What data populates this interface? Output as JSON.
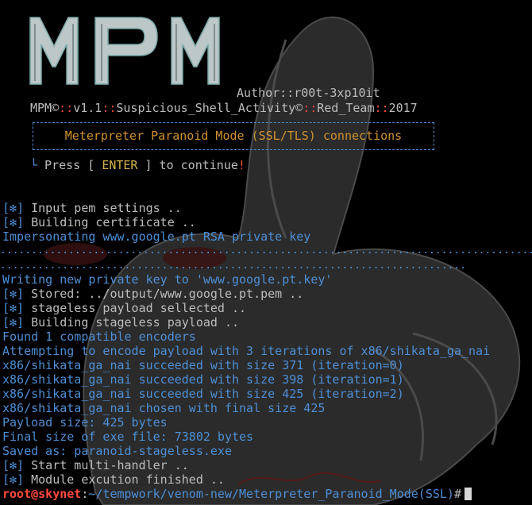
{
  "logo": {
    "text": "MPM"
  },
  "author_line": "Author::r00t-3xp10it",
  "version_line": {
    "part1": "MPM©",
    "sep1": "::",
    "part2": "v1.1",
    "sep2": "::",
    "part3": "Suspicious_Shell_Activity©",
    "sep3": "::",
    "part4": "Red_Team",
    "sep4": "::",
    "part5": "2017"
  },
  "banner": {
    "title": "Meterpreter Paranoid Mode (SSL/TLS) connections"
  },
  "continue": {
    "corner": "└",
    "pre": " Press [ ",
    "key": "ENTER",
    "post": " ] to continue",
    "bang": "!"
  },
  "log": [
    {
      "tag": "[✻]",
      "text": " Input pem settings .."
    },
    {
      "tag": "[✻]",
      "text": " Building certificate .."
    },
    {
      "text": "Impersonating www.google.pt RSA private key"
    }
  ],
  "dots_row1": "................................................................................................................",
  "dots_row2": "...........................................................................",
  "log2": [
    {
      "text": "Writing new private key to 'www.google.pt.key'"
    },
    {
      "tag": "[✻]",
      "text": " Stored: ../output/www.google.pt.pem .."
    },
    {
      "tag": "[✻]",
      "text": " stageless payload sellected .."
    },
    {
      "tag": "[✻]",
      "text": " Building stageless payload .."
    },
    {
      "text": "Found 1 compatible encoders"
    },
    {
      "text": "Attempting to encode payload with 3 iterations of x86/shikata_ga_nai"
    },
    {
      "text": "x86/shikata_ga_nai succeeded with size 371 (iteration=0)"
    },
    {
      "text": "x86/shikata_ga_nai succeeded with size 398 (iteration=1)"
    },
    {
      "text": "x86/shikata_ga_nai succeeded with size 425 (iteration=2)"
    },
    {
      "text": "x86/shikata_ga_nai chosen with final size 425"
    },
    {
      "text": "Payload size: 425 bytes"
    },
    {
      "text": "Final size of exe file: 73802 bytes"
    },
    {
      "text": "Saved as: paranoid-stageless.exe"
    },
    {
      "tag": "[✻]",
      "text": " Start multi-handler .."
    },
    {
      "tag": "[✻]",
      "text": " Module excution finished .."
    }
  ],
  "prompt": {
    "user": "root@skynet",
    "colon": ":",
    "path": "~/tempwork/venom-new/Meterpreter_Paranoid_Mode(SSL)",
    "symbol": "#"
  },
  "icons": {
    "cursor": "block-cursor-icon",
    "mascot": "bunny-mascot-watermark-icon"
  },
  "colors": {
    "background": "#000000",
    "blue": "#4d8fd6",
    "red": "#ff4a3d",
    "gray": "#bdbdbd",
    "orange": "#d0922f",
    "yellow": "#d6b44a"
  }
}
